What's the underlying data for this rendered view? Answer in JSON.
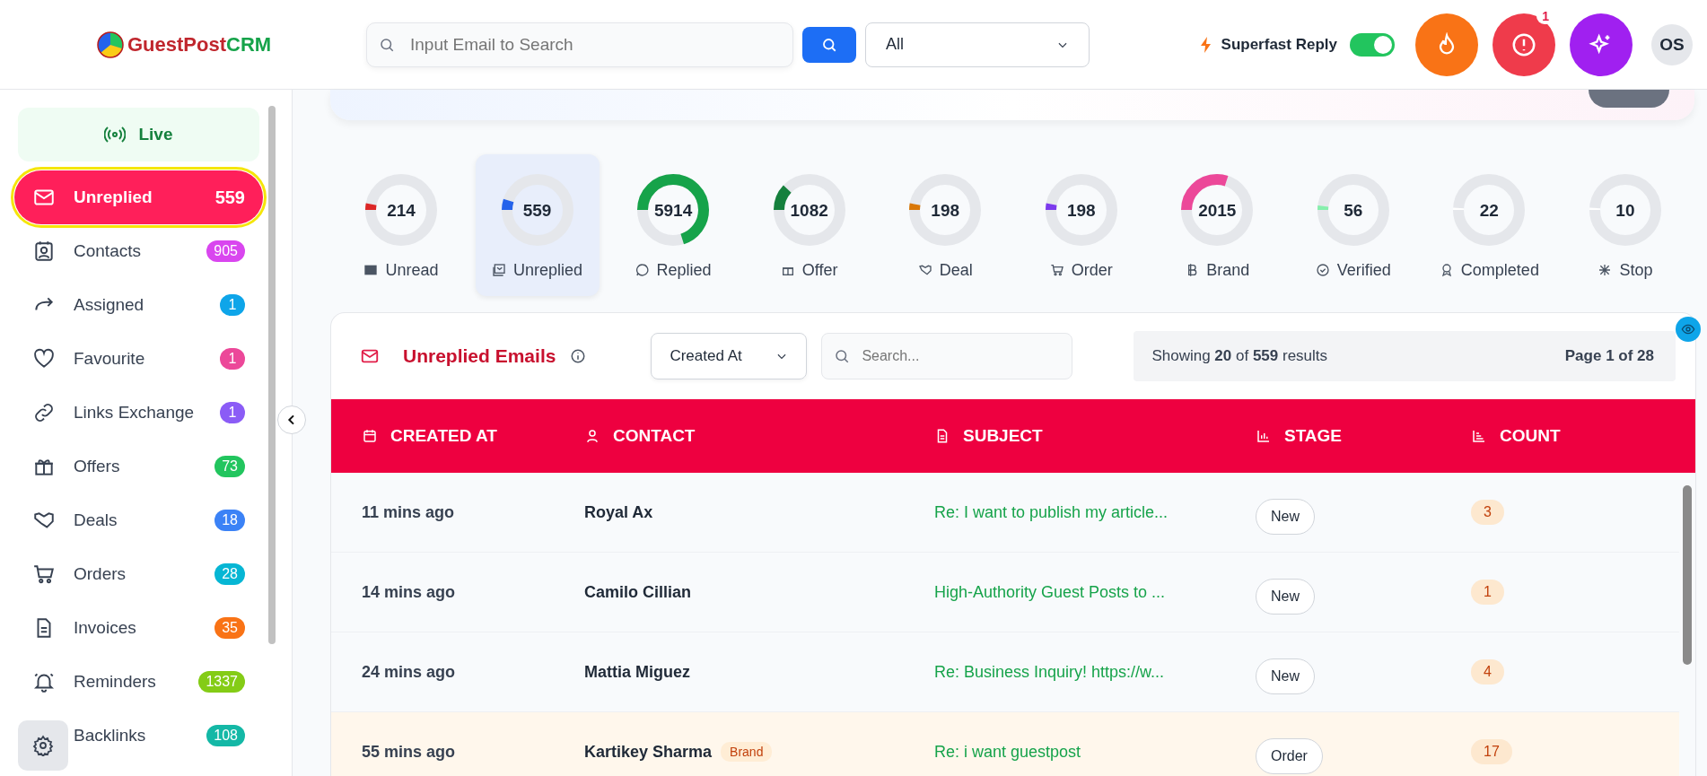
{
  "header": {
    "logo_text_1": "GuestPost",
    "logo_text_2": "CRM",
    "search": {
      "placeholder": "Input Email to Search"
    },
    "filter": {
      "value": "All"
    },
    "superfast_reply": {
      "label": "Superfast Reply",
      "on": true
    },
    "alert_count": "1",
    "avatar": "OS"
  },
  "sidebar": {
    "live": "Live",
    "items": [
      {
        "label": "Unreplied",
        "count": "559",
        "selected": true
      },
      {
        "label": "Contacts",
        "count": "905",
        "selected": false,
        "color": "#d946ef"
      },
      {
        "label": "Assigned",
        "count": "1",
        "selected": false,
        "color": "#0ea5e9"
      },
      {
        "label": "Favourite",
        "count": "1",
        "selected": false,
        "color": "#ec4899"
      },
      {
        "label": "Links Exchange",
        "count": "1",
        "selected": false,
        "color": "#8b5cf6"
      },
      {
        "label": "Offers",
        "count": "73",
        "selected": false,
        "color": "#22c55e"
      },
      {
        "label": "Deals",
        "count": "18",
        "selected": false,
        "color": "#3b82f6"
      },
      {
        "label": "Orders",
        "count": "28",
        "selected": false,
        "color": "#06b6d4"
      },
      {
        "label": "Invoices",
        "count": "35",
        "selected": false,
        "color": "#f97316"
      },
      {
        "label": "Reminders",
        "count": "1337",
        "selected": false,
        "color": "#84cc16"
      },
      {
        "label": "Backlinks",
        "count": "108",
        "selected": false,
        "color": "#14b8a6"
      }
    ]
  },
  "stats": [
    {
      "value": "214",
      "label": "Unread",
      "level": 0.03,
      "color": "#dc2626",
      "selected": false
    },
    {
      "value": "559",
      "label": "Unreplied",
      "level": 0.05,
      "color": "#2563eb",
      "selected": true
    },
    {
      "value": "5914",
      "label": "Replied",
      "level": 0.7,
      "color": "#16a34a",
      "selected": false
    },
    {
      "value": "1082",
      "label": "Offer",
      "level": 0.12,
      "color": "#15803d",
      "selected": false
    },
    {
      "value": "198",
      "label": "Deal",
      "level": 0.03,
      "color": "#d97706",
      "selected": false
    },
    {
      "value": "198",
      "label": "Order",
      "level": 0.03,
      "color": "#7c3aed",
      "selected": false
    },
    {
      "value": "2015",
      "label": "Brand",
      "level": 0.3,
      "color": "#ec4899",
      "selected": false
    },
    {
      "value": "56",
      "label": "Verified",
      "level": 0.02,
      "color": "#86efac",
      "selected": false
    },
    {
      "value": "22",
      "label": "Completed",
      "level": 0.01,
      "color": "#ffffff",
      "selected": false
    },
    {
      "value": "10",
      "label": "Stop",
      "level": 0.01,
      "color": "#ffffff",
      "selected": false
    }
  ],
  "table": {
    "title": "Unreplied Emails",
    "sort": {
      "value": "Created At"
    },
    "search": {
      "placeholder": "Search..."
    },
    "summary": "Showing **20** of **559** results",
    "page": "Page 1 of 28",
    "columns": [
      {
        "label": "CREATED AT"
      },
      {
        "label": "CONTACT"
      },
      {
        "label": "SUBJECT"
      },
      {
        "label": "STAGE"
      },
      {
        "label": "COUNT"
      }
    ],
    "rows": [
      {
        "created": "11 mins ago",
        "contact": "Royal Ax",
        "subject": "Re: I want to publish my article...",
        "stage": "New",
        "count": "3",
        "highlighted": false
      },
      {
        "created": "14 mins ago",
        "contact": "Camilo Cillian",
        "subject": "High-Authority Guest Posts to ...",
        "stage": "New",
        "count": "1",
        "highlighted": false
      },
      {
        "created": "24 mins ago",
        "contact": "Mattia Miguez",
        "subject": "Re: Business Inquiry! https://w...",
        "stage": "New",
        "count": "4",
        "highlighted": false
      },
      {
        "created": "55 mins ago",
        "contact": "Kartikey Sharma",
        "tag": "Brand",
        "subject": "Re: i want guestpost",
        "stage": "Order",
        "count": "17",
        "highlighted": true
      }
    ]
  }
}
